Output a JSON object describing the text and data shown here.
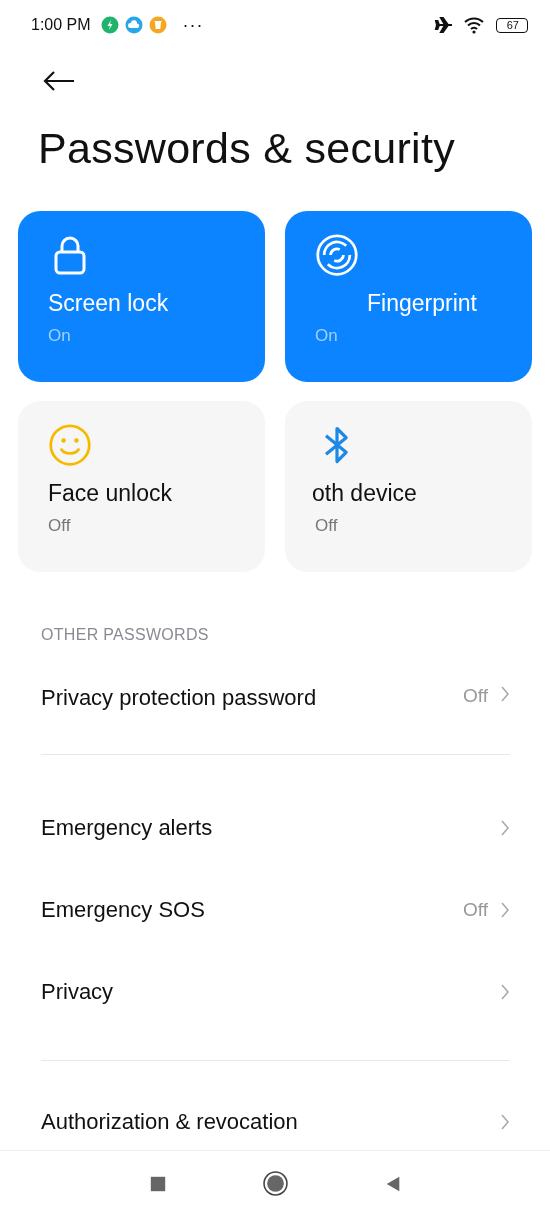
{
  "status_bar": {
    "time": "1:00 PM",
    "more": "···",
    "battery": "67"
  },
  "title": "Passwords & security",
  "cards": [
    {
      "kind": "lock",
      "title": "Screen lock",
      "status": "On",
      "on": true
    },
    {
      "kind": "fingerprint",
      "title": "Fingerprint",
      "status": "On",
      "on": true
    },
    {
      "kind": "face",
      "title": "Face unlock",
      "status": "Off",
      "on": false
    },
    {
      "kind": "bluetooth",
      "title": "oth device",
      "status": "Off",
      "on": false
    }
  ],
  "section_header": "OTHER PASSWORDS",
  "groups": [
    [
      {
        "label": "Privacy protection password",
        "value": "Off"
      }
    ],
    [
      {
        "label": "Emergency alerts"
      },
      {
        "label": "Emergency SOS",
        "value": "Off"
      },
      {
        "label": "Privacy"
      }
    ],
    [
      {
        "label": "Authorization & revocation"
      }
    ]
  ]
}
